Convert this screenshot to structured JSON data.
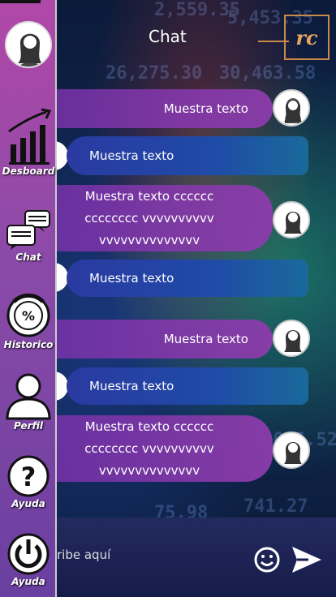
{
  "header": {
    "title": "Chat",
    "logo_text": "rc"
  },
  "sidebar": {
    "items": [
      {
        "label": "Desboard",
        "icon": "bar-chart-icon"
      },
      {
        "label": "Chat",
        "icon": "chat-bubbles-icon"
      },
      {
        "label": "Historico",
        "icon": "percent-icon"
      },
      {
        "label": "Perfil",
        "icon": "user-icon"
      },
      {
        "label": "Ayuda",
        "icon": "question-icon"
      },
      {
        "label": "Ayuda",
        "icon": "power-icon"
      }
    ]
  },
  "messages": [
    {
      "type": "sent",
      "lines": [
        "Muestra texto"
      ]
    },
    {
      "type": "received",
      "lines": [
        "Muestra texto"
      ]
    },
    {
      "type": "sent",
      "lines": [
        "Muestra texto cccccc",
        "cccccccc vvvvvvvvvv",
        "vvvvvvvvvvvvvv"
      ]
    },
    {
      "type": "received",
      "lines": [
        "Muestra texto"
      ]
    },
    {
      "type": "sent",
      "lines": [
        "Muestra texto"
      ]
    },
    {
      "type": "received",
      "lines": [
        "Muestra texto"
      ]
    },
    {
      "type": "sent",
      "lines": [
        "Muestra texto cccccc",
        "cccccccc vvvvvvvvvv",
        "vvvvvvvvvvvvvv"
      ]
    }
  ],
  "composer": {
    "placeholder": "ribe aquí"
  },
  "colors": {
    "sidebar": "#a048a8",
    "sent_bubble": "#8a3caa",
    "received_bubble": "#1f4aa8",
    "logo": "#e6a55e"
  }
}
